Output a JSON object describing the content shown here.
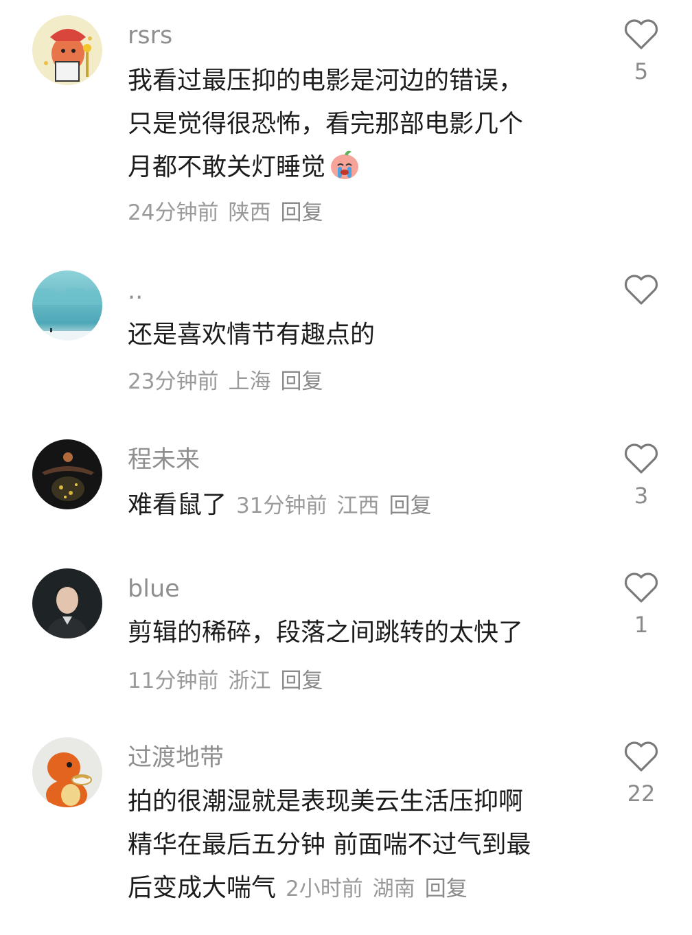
{
  "comments": [
    {
      "username": "rsrs",
      "avatar_icon": "cartoon-dinosaur-avatar",
      "text_lines": [
        "我看过最压抑的电影是河边的错误，",
        "只是觉得很恐怖，看完那部电影几个",
        "月都不敢关灯睡觉"
      ],
      "emoji_icon": "crying-face-emoji",
      "time": "24分钟前",
      "location": "陕西",
      "reply_label": "回复",
      "likes": "5"
    },
    {
      "username": "..",
      "avatar_icon": "blue-glacier-avatar",
      "text_lines": [
        "还是喜欢情节有趣点的"
      ],
      "time": "23分钟前",
      "location": "上海",
      "reply_label": "回复",
      "likes": ""
    },
    {
      "username": "程未来",
      "avatar_icon": "dark-figure-avatar",
      "text_lines": [
        "难看鼠了"
      ],
      "time": "31分钟前",
      "location": "江西",
      "reply_label": "回复",
      "likes": "3"
    },
    {
      "username": "blue",
      "avatar_icon": "portrait-man-avatar",
      "text_lines": [
        "剪辑的稀碎，段落之间跳转的太快了"
      ],
      "time": "11分钟前",
      "location": "浙江",
      "reply_label": "回复",
      "likes": "1"
    },
    {
      "username": "过渡地带",
      "avatar_icon": "orange-creature-avatar",
      "text_lines": [
        "拍的很潮湿就是表现美云生活压抑啊",
        "精华在最后五分钟 前面喘不过气到最",
        "后变成大喘气"
      ],
      "time": "2小时前",
      "location": "湖南",
      "reply_label": "回复",
      "likes": "22"
    }
  ],
  "colors": {
    "username": "#8f8f8f",
    "text": "#1c1c1c",
    "meta": "#9a9a9a",
    "heart_outline": "#7a7a7a"
  }
}
